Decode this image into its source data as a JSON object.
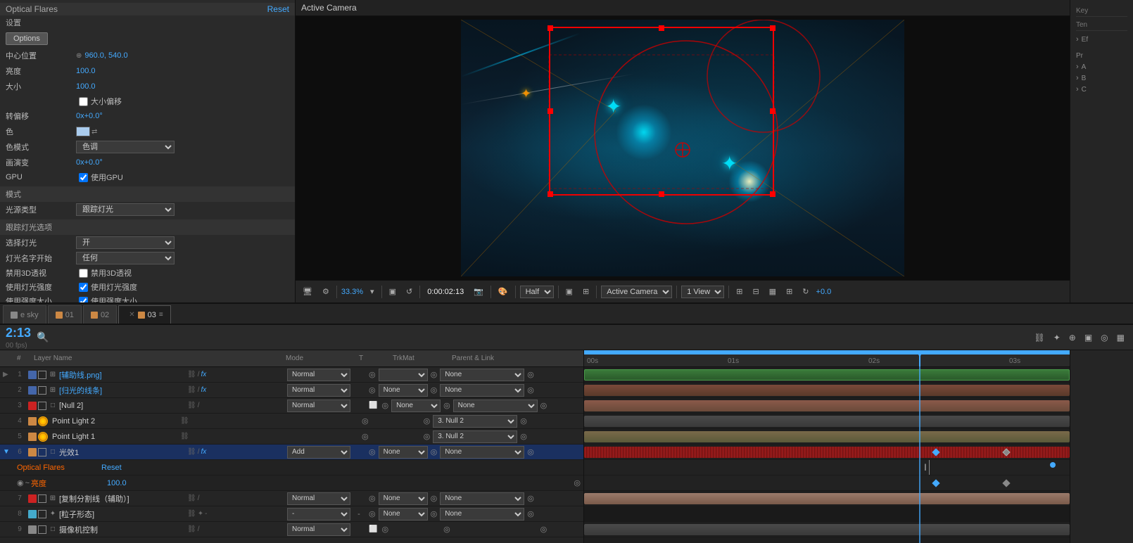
{
  "leftPanel": {
    "title": "Optical Flares",
    "resetLabel": "Reset",
    "setupLabel": "设置",
    "optionsLabel": "Options",
    "properties": [
      {
        "label": "中心位置",
        "value": "960.0, 540.0",
        "type": "blue",
        "icon": "⊕"
      },
      {
        "label": "亮度",
        "value": "100.0",
        "type": "blue"
      },
      {
        "label": "大小",
        "value": "100.0",
        "type": "blue"
      },
      {
        "label": "大小偏移",
        "value": "",
        "type": "checkbox",
        "checkLabel": "□大小偏移"
      },
      {
        "label": "转偏移",
        "value": "0x+0.0°",
        "type": "blue"
      },
      {
        "label": "色",
        "value": "",
        "type": "color"
      },
      {
        "label": "色模式",
        "value": "色调",
        "type": "dropdown"
      },
      {
        "label": "画演变",
        "value": "0x+0.0°",
        "type": "blue"
      },
      {
        "label": "GPU",
        "value": "",
        "type": "checkbox",
        "checkLabel": "☑使用GPU"
      },
      {
        "label": "模式",
        "value": "",
        "type": "section"
      },
      {
        "label": "光源类型",
        "value": "跟踪灯光",
        "type": "dropdown"
      },
      {
        "label": "跟踪灯光选项",
        "value": "",
        "type": "section"
      },
      {
        "label": "选择灯光",
        "value": "开",
        "type": "dropdown"
      },
      {
        "label": "灯光名字开始",
        "value": "任何",
        "type": "dropdown"
      },
      {
        "label": "禁用3D透视",
        "value": "",
        "type": "checkbox2",
        "checkLabel": "□禁用3D透视"
      },
      {
        "label": "使用灯光强度",
        "value": "",
        "type": "checkbox3",
        "checkLabel": "☑使用灯光强度"
      },
      {
        "label": "使用强度大小",
        "value": "",
        "type": "checkbox4",
        "checkLabel": "☑使用强度大小"
      }
    ]
  },
  "viewport": {
    "label": "Active Camera",
    "zoom": "33.3%",
    "time": "0:00:02:13",
    "quality": "Half",
    "cameraMode": "Active Camera",
    "viewCount": "1 View",
    "delta": "+0.0"
  },
  "rightPanel": {
    "keyLabel": "Key",
    "tempLabel": "Ten",
    "sections": [
      {
        "label": "Ef"
      },
      {
        "label": "A"
      },
      {
        "label": "B"
      },
      {
        "label": "C"
      }
    ]
  },
  "timeline": {
    "time": "2:13",
    "fps": "00 fps)",
    "tabs": [
      {
        "label": "e sky",
        "color": "#888",
        "active": false
      },
      {
        "label": "01",
        "color": "#cc8844",
        "active": false
      },
      {
        "label": "02",
        "color": "#cc8844",
        "active": false
      },
      {
        "label": "03",
        "color": "#cc8844",
        "active": true
      }
    ],
    "toolbar": {
      "icons": [
        "⛓",
        "✦",
        "⊕",
        "▣",
        "◎",
        "▦"
      ]
    },
    "columns": {
      "layerName": "Layer Name",
      "mode": "Mode",
      "t": "T",
      "trkmat": "TrkMat",
      "parentLink": "Parent & Link"
    },
    "layers": [
      {
        "num": "1",
        "color": "#4466aa",
        "hasBox": true,
        "type": "grid",
        "name": "[辅助线.png]",
        "nameColor": "blue",
        "icons": "⛓ / fx",
        "mode": "Normal",
        "t": "",
        "trkmat": "",
        "parent": "None",
        "expand": true
      },
      {
        "num": "2",
        "color": "#4466aa",
        "hasBox": true,
        "type": "grid",
        "name": "[归光的线条]",
        "nameColor": "blue",
        "icons": "⛓ / fx",
        "mode": "Normal",
        "t": "",
        "trkmat": "None",
        "parent": "None",
        "expand": false
      },
      {
        "num": "3",
        "color": "#cc2222",
        "hasBox": true,
        "type": "null",
        "name": "[Null 2]",
        "nameColor": "normal",
        "icons": "⛓ /",
        "mode": "Normal",
        "t": "",
        "trkmat": "None",
        "parent": "None",
        "expand": false
      },
      {
        "num": "4",
        "color": "#cc8844",
        "hasBox": false,
        "type": "light",
        "name": "Point Light 2",
        "nameColor": "normal",
        "icons": "⛓",
        "mode": "",
        "t": "",
        "trkmat": "",
        "parent": "3. Null 2",
        "expand": false
      },
      {
        "num": "5",
        "color": "#cc8844",
        "hasBox": false,
        "type": "light",
        "name": "Point Light 1",
        "nameColor": "normal",
        "icons": "⛓",
        "mode": "",
        "t": "",
        "trkmat": "",
        "parent": "3. Null 2",
        "expand": false
      },
      {
        "num": "6",
        "color": "#cc8844",
        "hasBox": true,
        "type": "solid",
        "name": "光效1",
        "nameColor": "normal",
        "icons": "⛓ / fx",
        "mode": "Add",
        "t": "",
        "trkmat": "None",
        "parent": "None",
        "expand": true,
        "selected": true
      },
      {
        "num": "7",
        "color": "#cc2222",
        "hasBox": true,
        "type": "grid",
        "name": "[复制分割线（辅助）]",
        "nameColor": "normal",
        "icons": "⛓ /",
        "mode": "Normal",
        "t": "",
        "trkmat": "None",
        "parent": "None",
        "expand": false
      },
      {
        "num": "8",
        "color": "#44aacc",
        "hasBox": true,
        "type": "particle",
        "name": "[粒子形态]",
        "nameColor": "normal",
        "icons": "⛓ ✦ -",
        "mode": "-",
        "t": "-",
        "trkmat": "None",
        "parent": "None",
        "expand": false
      },
      {
        "num": "9",
        "color": "#888888",
        "hasBox": true,
        "type": "null",
        "name": "摄像机控制",
        "nameColor": "normal",
        "icons": "⛓ /",
        "mode": "Normal",
        "t": "",
        "trkmat": "",
        "parent": "",
        "expand": false
      }
    ],
    "subRows": [
      {
        "type": "optical-flares",
        "label": "Optical Flares",
        "hasReset": true,
        "resetLabel": "Reset"
      },
      {
        "type": "brightness",
        "label": "◉ ~ 亮度",
        "value": "100.0"
      }
    ],
    "tracks": {
      "rulerMarks": [
        {
          "label": "00s",
          "pos": 4
        },
        {
          "label": "01s",
          "pos": 200
        },
        {
          "label": "02s",
          "pos": 400
        },
        {
          "label": "03s",
          "pos": 600
        }
      ],
      "playheadPos": 480,
      "cursorPos": 490
    }
  }
}
